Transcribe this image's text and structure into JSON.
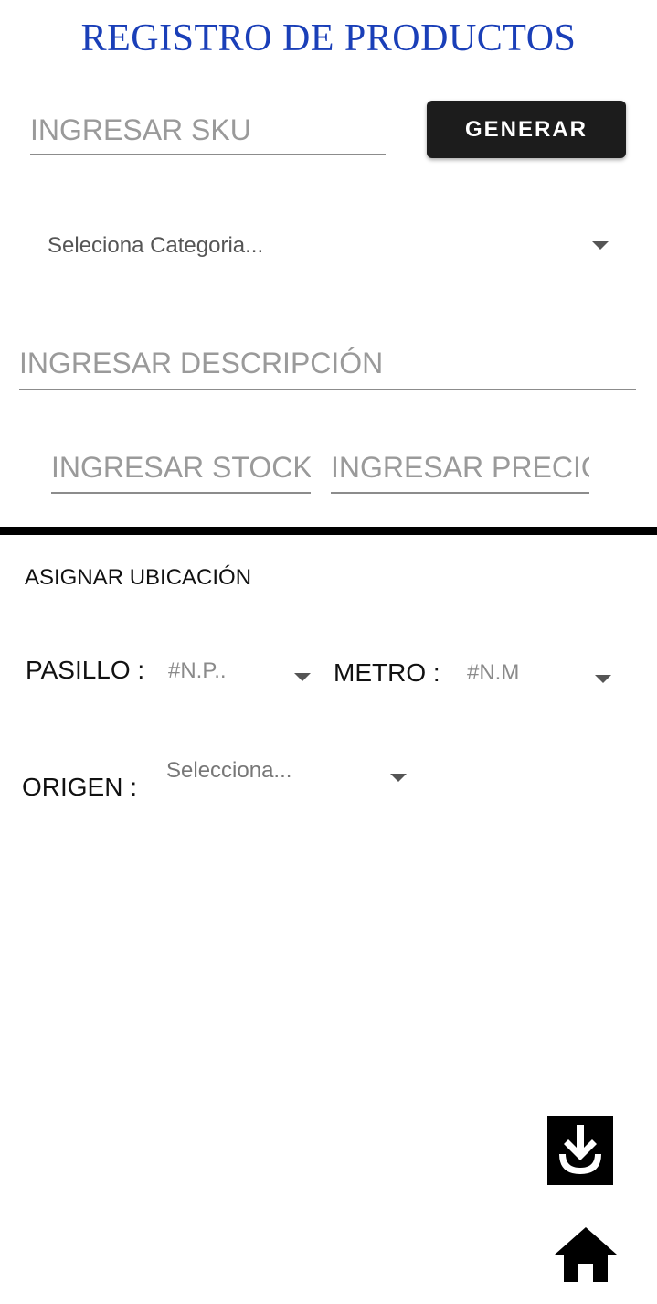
{
  "header": {
    "title": "REGISTRO DE PRODUCTOS"
  },
  "form": {
    "sku": {
      "placeholder": "INGRESAR SKU",
      "value": ""
    },
    "generate_label": "GENERAR",
    "category": {
      "selected": "Seleciona Categoria..."
    },
    "description": {
      "placeholder": "INGRESAR DESCRIPCIÓN",
      "value": ""
    },
    "stock": {
      "placeholder": "INGRESAR STOCK",
      "value": ""
    },
    "price": {
      "placeholder": "INGRESAR PRECIO",
      "value": ""
    }
  },
  "location": {
    "section_label": "ASIGNAR UBICACIÓN",
    "pasillo_label": "PASILLO :",
    "pasillo_selected": "#N.P..",
    "metro_label": "METRO :",
    "metro_selected": "#N.M",
    "origen_label": "ORIGEN :",
    "origen_selected": "Selecciona..."
  },
  "actions": {
    "download_icon": "download-icon",
    "home_icon": "home-icon"
  },
  "colors": {
    "title": "#1a3fb8",
    "button_bg": "#1c1c1c",
    "divider": "#000000"
  }
}
